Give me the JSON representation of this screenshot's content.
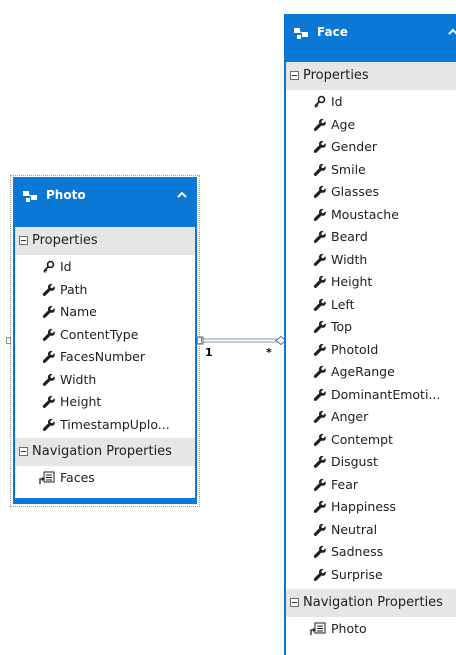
{
  "entities": {
    "photo": {
      "name": "Photo",
      "section_properties": "Properties",
      "properties": [
        {
          "name": "Id",
          "key": true
        },
        {
          "name": "Path",
          "key": false
        },
        {
          "name": "Name",
          "key": false
        },
        {
          "name": "ContentType",
          "key": false
        },
        {
          "name": "FacesNumber",
          "key": false
        },
        {
          "name": "Width",
          "key": false
        },
        {
          "name": "Height",
          "key": false
        },
        {
          "name": "TimestampUplo...",
          "key": false
        }
      ],
      "section_navigation": "Navigation Properties",
      "navigation": [
        {
          "name": "Faces"
        }
      ]
    },
    "face": {
      "name": "Face",
      "section_properties": "Properties",
      "properties": [
        {
          "name": "Id",
          "key": true
        },
        {
          "name": "Age",
          "key": false
        },
        {
          "name": "Gender",
          "key": false
        },
        {
          "name": "Smile",
          "key": false
        },
        {
          "name": "Glasses",
          "key": false
        },
        {
          "name": "Moustache",
          "key": false
        },
        {
          "name": "Beard",
          "key": false
        },
        {
          "name": "Width",
          "key": false
        },
        {
          "name": "Height",
          "key": false
        },
        {
          "name": "Left",
          "key": false
        },
        {
          "name": "Top",
          "key": false
        },
        {
          "name": "PhotoId",
          "key": false
        },
        {
          "name": "AgeRange",
          "key": false
        },
        {
          "name": "DominantEmoti...",
          "key": false
        },
        {
          "name": "Anger",
          "key": false
        },
        {
          "name": "Contempt",
          "key": false
        },
        {
          "name": "Disgust",
          "key": false
        },
        {
          "name": "Fear",
          "key": false
        },
        {
          "name": "Happiness",
          "key": false
        },
        {
          "name": "Neutral",
          "key": false
        },
        {
          "name": "Sadness",
          "key": false
        },
        {
          "name": "Surprise",
          "key": false
        }
      ],
      "section_navigation": "Navigation Properties",
      "navigation": [
        {
          "name": "Photo"
        }
      ]
    }
  },
  "association": {
    "photo_end": "1",
    "face_end": "*"
  },
  "colors": {
    "entity_header": "#0a78d4",
    "section_bg": "#e6e6e6",
    "text": "#1e1e1e",
    "icon": "#1e1e1e"
  },
  "icons": {
    "entity": "entity-type-icon",
    "key_property": "key-property-icon",
    "scalar_property": "wrench-property-icon",
    "navigation_property": "navigation-property-icon",
    "collapse": "chevron-up-icon",
    "section_toggle": "minus-box-icon"
  }
}
